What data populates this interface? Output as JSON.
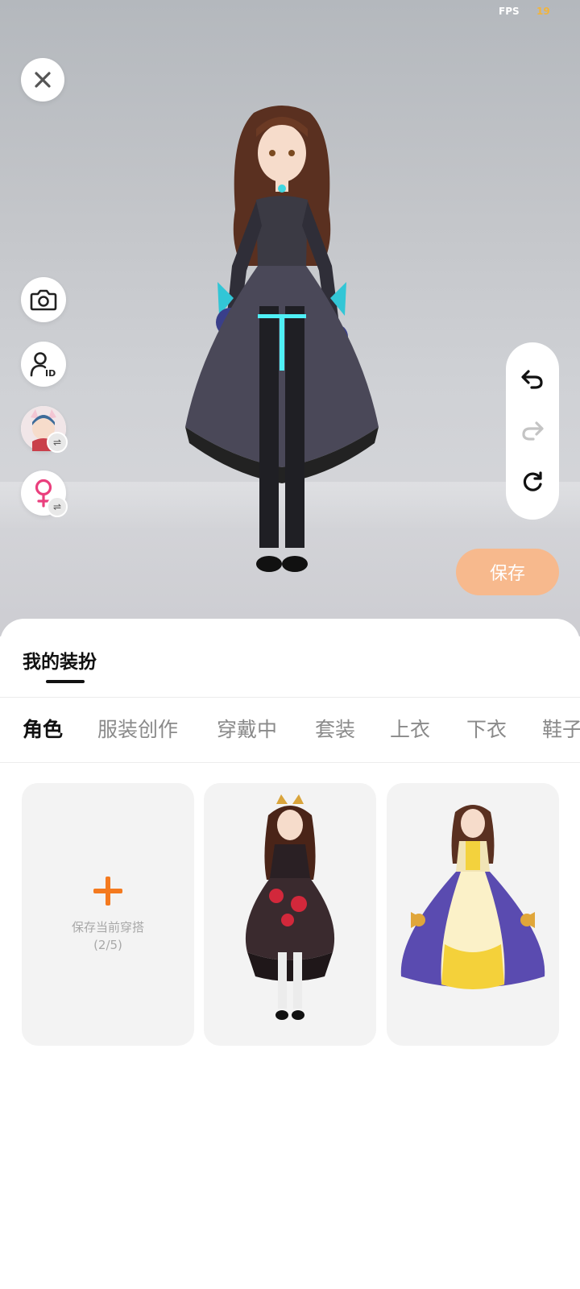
{
  "status": {
    "fps_label": "FPS",
    "fps_value": "19"
  },
  "stage": {
    "save_label": "保存"
  },
  "sheet": {
    "title": "我的装扮",
    "tabs": [
      {
        "label": "角色",
        "active": true
      },
      {
        "label": "服装创作",
        "active": false
      },
      {
        "label": "穿戴中",
        "active": false
      },
      {
        "label": "套装",
        "active": false
      },
      {
        "label": "上衣",
        "active": false
      },
      {
        "label": "下衣",
        "active": false
      },
      {
        "label": "鞋子",
        "active": false
      }
    ],
    "add_card": {
      "label": "保存当前穿搭",
      "count": "(2/5)"
    }
  },
  "colors": {
    "accent": "#f47a1f",
    "save_button": "#f7b98d",
    "fps_value": "#f2b43c"
  },
  "icons": [
    "close-icon",
    "camera-icon",
    "user-id-icon",
    "female-icon",
    "swap-icon",
    "undo-icon",
    "redo-icon",
    "reset-icon",
    "plus-icon"
  ]
}
